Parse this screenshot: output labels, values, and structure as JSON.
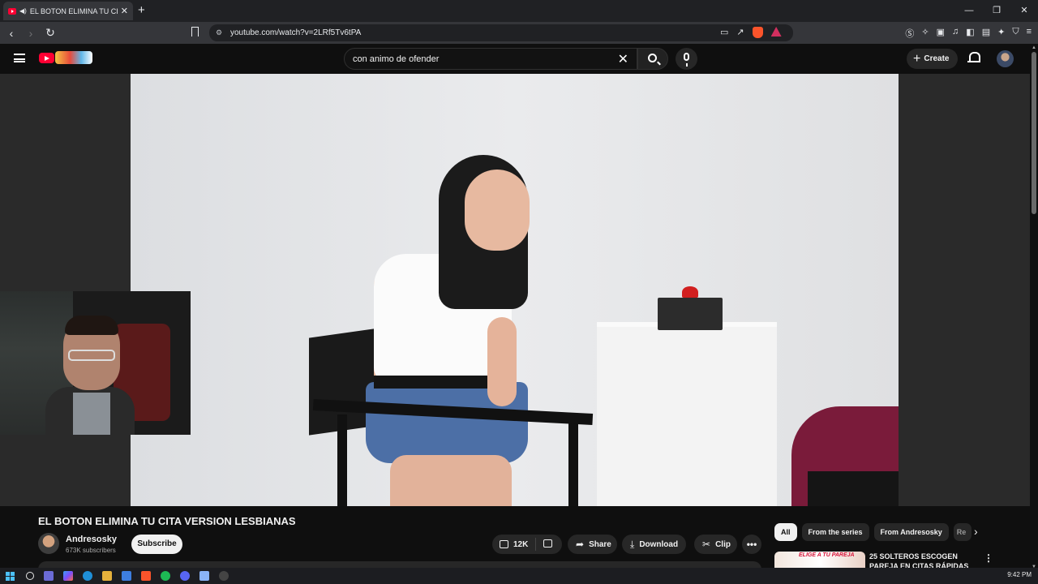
{
  "browser": {
    "tab_title": "EL BOTON ELIMINA TU CITA V",
    "url": "youtube.com/watch?v=2LRf5Tv6tPA",
    "window_controls": [
      "—",
      "❐",
      "✕"
    ]
  },
  "masthead": {
    "search_value": "con animo de ofender",
    "create_label": "Create"
  },
  "video": {
    "title": "EL BOTON ELIMINA TU CITA VERSION LESBIANAS",
    "channel_name": "Andresosky",
    "subscribers": "673K subscribers",
    "subscribe_label": "Subscribe",
    "like_count": "12K",
    "share_label": "Share",
    "download_label": "Download",
    "clip_label": "Clip"
  },
  "chips": [
    "All",
    "From the series",
    "From Andresosky",
    "Re"
  ],
  "recommendation": {
    "thumb_text": "ELIGE A TU PAREJA",
    "title": "25 SOLTEROS ESCOGEN PAREJA EN CITAS RÁPIDAS"
  },
  "taskbar": {
    "time": "9:42 PM"
  },
  "icons": {
    "accent_red": "#ff0033",
    "brave": "#fb542b"
  }
}
